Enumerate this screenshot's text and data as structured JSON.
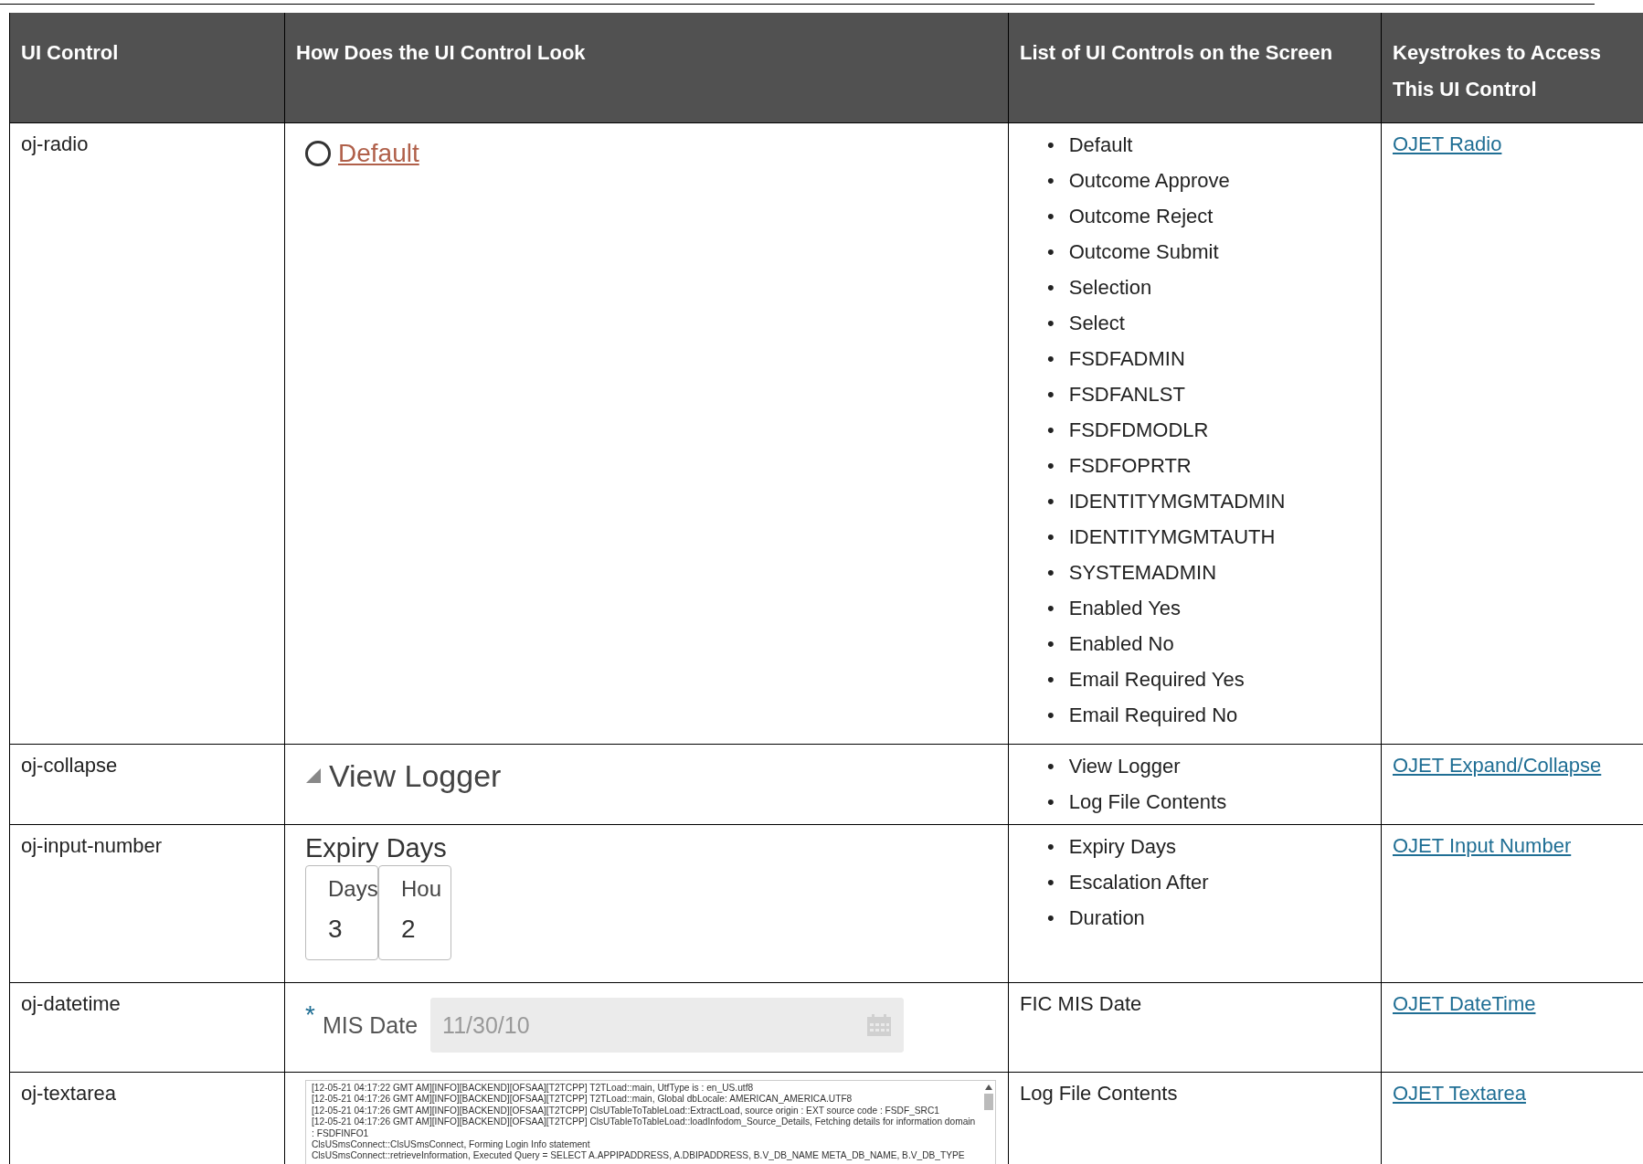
{
  "table": {
    "columns": [
      "UI Control",
      "How Does the UI Control Look",
      "List of UI Controls on the Screen",
      "Keystrokes to Access This UI Control"
    ],
    "rows": [
      {
        "control": "oj-radio",
        "look": {
          "kind": "radio",
          "label": "Default",
          "selected": false
        },
        "list": {
          "kind": "bullets",
          "items": [
            {
              "bullet": "•",
              "text": "Default"
            },
            {
              "bullet": "•",
              "text": "Outcome Approve"
            },
            {
              "bullet": "•",
              "text": "Outcome Reject"
            },
            {
              "bullet": "•",
              "text": "Outcome Submit"
            },
            {
              "bullet": "•",
              "text": "Selection"
            },
            {
              "bullet": "•",
              "text": "Select"
            },
            {
              "bullet": "•",
              "text": "FSDFADMIN"
            },
            {
              "bullet": "•",
              "text": "FSDFANLST"
            },
            {
              "bullet": "•",
              "text": "FSDFDMODLR"
            },
            {
              "bullet": "•",
              "text": "FSDFOPRTR"
            },
            {
              "bullet": "•",
              "text": "IDENTITYMGMTADMIN"
            },
            {
              "bullet": "•",
              "text": "IDENTITYMGMTAUTH"
            },
            {
              "bullet": "•",
              "text": "SYSTEMADMIN"
            },
            {
              "bullet": "•",
              "text": "Enabled Yes"
            },
            {
              "bullet": "•",
              "text": "Enabled No"
            },
            {
              "bullet": "•",
              "text": "Email Required Yes"
            },
            {
              "bullet": "•",
              "text": "Email Required No"
            }
          ]
        },
        "link": "OJET Radio"
      },
      {
        "control": "oj-collapse",
        "look": {
          "kind": "collapse",
          "label": "View Logger",
          "expanded": true
        },
        "list": {
          "kind": "bullets",
          "items": [
            {
              "bullet": "•",
              "text": "View Logger"
            },
            {
              "bullet": "•",
              "text": "Log File Contents"
            }
          ]
        },
        "link": "OJET Expand/Collapse"
      },
      {
        "control": "oj-input-number",
        "look": {
          "kind": "number",
          "label": "Expiry Days",
          "fields": [
            {
              "label": "Days",
              "value": "3"
            },
            {
              "label": "Hou",
              "value": "2"
            }
          ]
        },
        "list": {
          "kind": "bullets",
          "items": [
            {
              "bullet": "•",
              "text": "Expiry Days"
            },
            {
              "bullet": "•",
              "text": "Escalation After"
            },
            {
              "bullet": "•",
              "text": "Duration"
            }
          ]
        },
        "link": "OJET Input Number"
      },
      {
        "control": "oj-datetime",
        "look": {
          "kind": "date",
          "label": "MIS Date",
          "required_mark": "*",
          "disabled": true,
          "value": "11/30/10"
        },
        "list": {
          "kind": "text",
          "text": "FIC MIS Date"
        },
        "link": "OJET DateTime"
      },
      {
        "control": "oj-textarea",
        "look": {
          "kind": "textarea",
          "lines": [
            "[12-05-21 04:17:22 GMT AM][INFO][BACKEND][OFSAA][T2TCPP] T2TLoad::main, UtfType is : en_US.utf8",
            "[12-05-21 04:17:26 GMT AM][INFO][BACKEND][OFSAA][T2TCPP] T2TLoad::main, Global dbLocale: AMERICAN_AMERICA.UTF8",
            "[12-05-21 04:17:26 GMT AM][INFO][BACKEND][OFSAA][T2TCPP] ClsUTableToTableLoad::ExtractLoad, source origin : EXT source code : FSDF_SRC1",
            "[12-05-21 04:17:26 GMT AM][INFO][BACKEND][OFSAA][T2TCPP] ClsUTableToTableLoad::loadInfodom_Source_Details, Fetching details for information domain : FSDFINFO1",
            "ClsUSmsConnect::ClsUSmsConnect, Forming Login Info statement",
            "ClsUSmsConnect::retrieveInformation, Executed Query = SELECT A.APPIPADDRESS, A.DBIPADDRESS, B.V_DB_NAME META_DB_NAME, B.V_DB_TYPE"
          ]
        },
        "list": {
          "kind": "text",
          "text": "Log File Contents"
        },
        "link": "OJET Textarea"
      }
    ]
  }
}
